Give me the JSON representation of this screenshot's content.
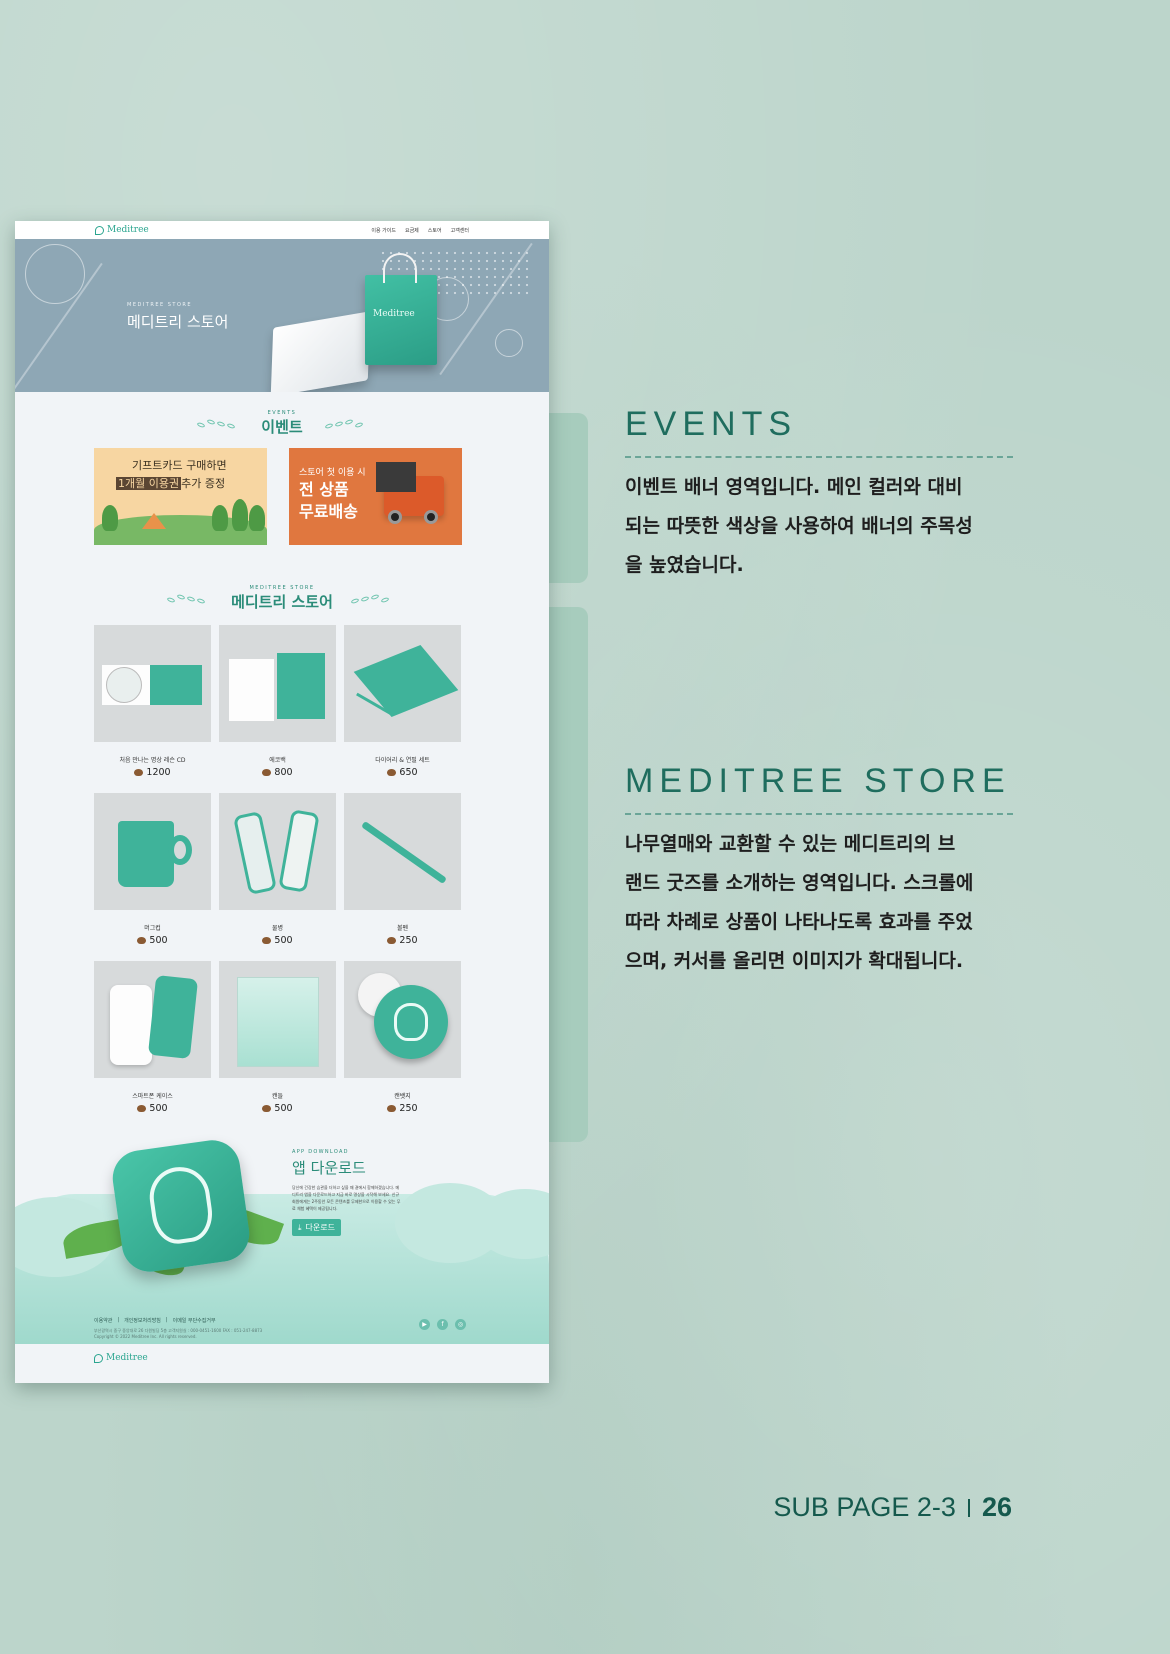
{
  "mockup": {
    "logo": "Meditree",
    "menu": [
      "이용 가이드",
      "요금제",
      "스토어",
      "고객센터"
    ],
    "hero": {
      "small": "MEDITREE STORE",
      "title": "메디트리 스토어",
      "bag_logo": "Meditree"
    },
    "events_section": {
      "small": "EVENTS",
      "title": "이벤트"
    },
    "banner1": {
      "line1": "기프트카드 구매하면",
      "highlight": "1개월 이용권",
      "line2_rest": "추가 증정"
    },
    "banner2": {
      "line1": "스토어 첫 이용 시",
      "line2": "전 상품",
      "line3": "무료배송"
    },
    "store_section": {
      "small": "MEDITREE STORE",
      "title": "메디트리 스토어"
    },
    "products": [
      {
        "name": "처음 만나는 명상 레슨 CD",
        "price": "1200"
      },
      {
        "name": "에코백",
        "price": "800"
      },
      {
        "name": "다이어리 & 연필 세트",
        "price": "650"
      },
      {
        "name": "머그컵",
        "price": "500"
      },
      {
        "name": "물병",
        "price": "500"
      },
      {
        "name": "볼펜",
        "price": "250"
      },
      {
        "name": "스마트폰 케이스",
        "price": "500"
      },
      {
        "name": "캔들",
        "price": "500"
      },
      {
        "name": "캔뱃지",
        "price": "250"
      }
    ],
    "app": {
      "small": "APP DOWNLOAD",
      "title": "앱 다운로드",
      "desc": "당신에 건강한 습관을 더하고 싶을 때 곁에서 함께하겠습니다. 메디트리 앱을 다운로드하고 지금 바로 명상을 시작해 보세요. 신규 회원에게는 2주동안 모든 콘텐츠를 무제한으로 이용할 수 있는 무료 체험 혜택이 제공됩니다.",
      "button": "다운로드"
    },
    "footer": {
      "links": [
        "이용약관",
        "개인정보처리방침",
        "이메일 무단수집거부"
      ],
      "info1": "부산광역시 중구 중앙대로 26 다원빌딩 5층 고객지원실 : 000-0451-1600 FAX : 051-247-8873",
      "info2": "Copyright © 2022 Meditree Inc. All rights reserved.",
      "logo": "Meditree"
    }
  },
  "right": {
    "events": {
      "title": "EVENTS",
      "desc": [
        "이벤트 배너 영역입니다. 메인 컬러와 대비",
        "되는 따뜻한 색상을 사용하여 배너의 주목성",
        "을 높였습니다."
      ]
    },
    "store": {
      "title": "MEDITREE STORE",
      "desc": [
        "나무열매와 교환할 수 있는 메디트리의 브",
        "랜드 굿즈를 소개하는 영역입니다. 스크롤에",
        "따라 차례로 상품이 나타나도록 효과를 주었",
        "으며, 커서를 올리면 이미지가 확대됩니다."
      ]
    }
  },
  "page": {
    "label": "SUB PAGE 2-3",
    "number": "26"
  },
  "colors": {
    "accent": "#2aa58f",
    "background": "#bcd5cb",
    "hero": "#8ea7b5",
    "banner_warm": "#e0773f"
  }
}
